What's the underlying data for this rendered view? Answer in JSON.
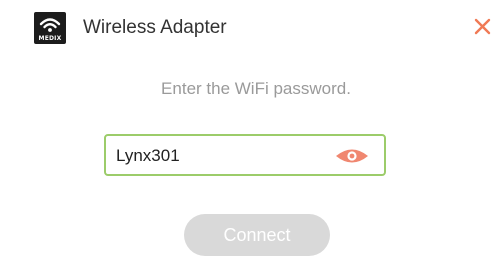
{
  "window": {
    "title": "Wireless Adapter",
    "app_icon": "wifi-router-icon",
    "app_icon_brand": "MEDIX",
    "close_icon": "close-x-icon"
  },
  "prompt": {
    "instruction": "Enter the WiFi password."
  },
  "password_field": {
    "value": "Lynx301",
    "visibility_icon": "eye-icon",
    "border_color": "#9ccc6a",
    "icon_color": "#f08770"
  },
  "actions": {
    "connect_label": "Connect",
    "connect_enabled": false
  },
  "colors": {
    "accent_close": "#f07a55",
    "button_disabled": "#d9d9d9",
    "title_text": "#333333",
    "instruction_text": "#9a9a9a"
  }
}
